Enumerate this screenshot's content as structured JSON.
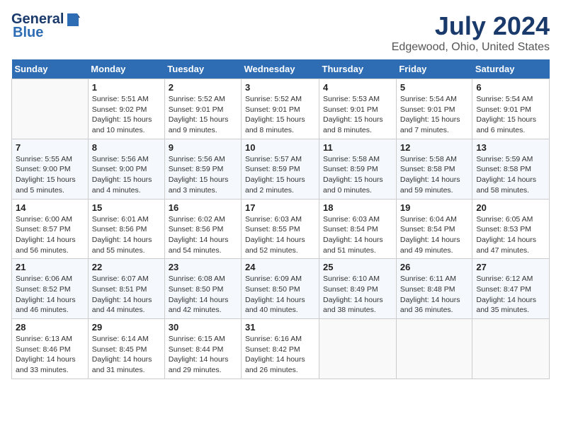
{
  "header": {
    "logo_general": "General",
    "logo_blue": "Blue",
    "title": "July 2024",
    "subtitle": "Edgewood, Ohio, United States"
  },
  "calendar": {
    "days_of_week": [
      "Sunday",
      "Monday",
      "Tuesday",
      "Wednesday",
      "Thursday",
      "Friday",
      "Saturday"
    ],
    "weeks": [
      [
        {
          "num": "",
          "info": ""
        },
        {
          "num": "1",
          "info": "Sunrise: 5:51 AM\nSunset: 9:02 PM\nDaylight: 15 hours\nand 10 minutes."
        },
        {
          "num": "2",
          "info": "Sunrise: 5:52 AM\nSunset: 9:01 PM\nDaylight: 15 hours\nand 9 minutes."
        },
        {
          "num": "3",
          "info": "Sunrise: 5:52 AM\nSunset: 9:01 PM\nDaylight: 15 hours\nand 8 minutes."
        },
        {
          "num": "4",
          "info": "Sunrise: 5:53 AM\nSunset: 9:01 PM\nDaylight: 15 hours\nand 8 minutes."
        },
        {
          "num": "5",
          "info": "Sunrise: 5:54 AM\nSunset: 9:01 PM\nDaylight: 15 hours\nand 7 minutes."
        },
        {
          "num": "6",
          "info": "Sunrise: 5:54 AM\nSunset: 9:01 PM\nDaylight: 15 hours\nand 6 minutes."
        }
      ],
      [
        {
          "num": "7",
          "info": "Sunrise: 5:55 AM\nSunset: 9:00 PM\nDaylight: 15 hours\nand 5 minutes."
        },
        {
          "num": "8",
          "info": "Sunrise: 5:56 AM\nSunset: 9:00 PM\nDaylight: 15 hours\nand 4 minutes."
        },
        {
          "num": "9",
          "info": "Sunrise: 5:56 AM\nSunset: 8:59 PM\nDaylight: 15 hours\nand 3 minutes."
        },
        {
          "num": "10",
          "info": "Sunrise: 5:57 AM\nSunset: 8:59 PM\nDaylight: 15 hours\nand 2 minutes."
        },
        {
          "num": "11",
          "info": "Sunrise: 5:58 AM\nSunset: 8:59 PM\nDaylight: 15 hours\nand 0 minutes."
        },
        {
          "num": "12",
          "info": "Sunrise: 5:58 AM\nSunset: 8:58 PM\nDaylight: 14 hours\nand 59 minutes."
        },
        {
          "num": "13",
          "info": "Sunrise: 5:59 AM\nSunset: 8:58 PM\nDaylight: 14 hours\nand 58 minutes."
        }
      ],
      [
        {
          "num": "14",
          "info": "Sunrise: 6:00 AM\nSunset: 8:57 PM\nDaylight: 14 hours\nand 56 minutes."
        },
        {
          "num": "15",
          "info": "Sunrise: 6:01 AM\nSunset: 8:56 PM\nDaylight: 14 hours\nand 55 minutes."
        },
        {
          "num": "16",
          "info": "Sunrise: 6:02 AM\nSunset: 8:56 PM\nDaylight: 14 hours\nand 54 minutes."
        },
        {
          "num": "17",
          "info": "Sunrise: 6:03 AM\nSunset: 8:55 PM\nDaylight: 14 hours\nand 52 minutes."
        },
        {
          "num": "18",
          "info": "Sunrise: 6:03 AM\nSunset: 8:54 PM\nDaylight: 14 hours\nand 51 minutes."
        },
        {
          "num": "19",
          "info": "Sunrise: 6:04 AM\nSunset: 8:54 PM\nDaylight: 14 hours\nand 49 minutes."
        },
        {
          "num": "20",
          "info": "Sunrise: 6:05 AM\nSunset: 8:53 PM\nDaylight: 14 hours\nand 47 minutes."
        }
      ],
      [
        {
          "num": "21",
          "info": "Sunrise: 6:06 AM\nSunset: 8:52 PM\nDaylight: 14 hours\nand 46 minutes."
        },
        {
          "num": "22",
          "info": "Sunrise: 6:07 AM\nSunset: 8:51 PM\nDaylight: 14 hours\nand 44 minutes."
        },
        {
          "num": "23",
          "info": "Sunrise: 6:08 AM\nSunset: 8:50 PM\nDaylight: 14 hours\nand 42 minutes."
        },
        {
          "num": "24",
          "info": "Sunrise: 6:09 AM\nSunset: 8:50 PM\nDaylight: 14 hours\nand 40 minutes."
        },
        {
          "num": "25",
          "info": "Sunrise: 6:10 AM\nSunset: 8:49 PM\nDaylight: 14 hours\nand 38 minutes."
        },
        {
          "num": "26",
          "info": "Sunrise: 6:11 AM\nSunset: 8:48 PM\nDaylight: 14 hours\nand 36 minutes."
        },
        {
          "num": "27",
          "info": "Sunrise: 6:12 AM\nSunset: 8:47 PM\nDaylight: 14 hours\nand 35 minutes."
        }
      ],
      [
        {
          "num": "28",
          "info": "Sunrise: 6:13 AM\nSunset: 8:46 PM\nDaylight: 14 hours\nand 33 minutes."
        },
        {
          "num": "29",
          "info": "Sunrise: 6:14 AM\nSunset: 8:45 PM\nDaylight: 14 hours\nand 31 minutes."
        },
        {
          "num": "30",
          "info": "Sunrise: 6:15 AM\nSunset: 8:44 PM\nDaylight: 14 hours\nand 29 minutes."
        },
        {
          "num": "31",
          "info": "Sunrise: 6:16 AM\nSunset: 8:42 PM\nDaylight: 14 hours\nand 26 minutes."
        },
        {
          "num": "",
          "info": ""
        },
        {
          "num": "",
          "info": ""
        },
        {
          "num": "",
          "info": ""
        }
      ]
    ]
  }
}
